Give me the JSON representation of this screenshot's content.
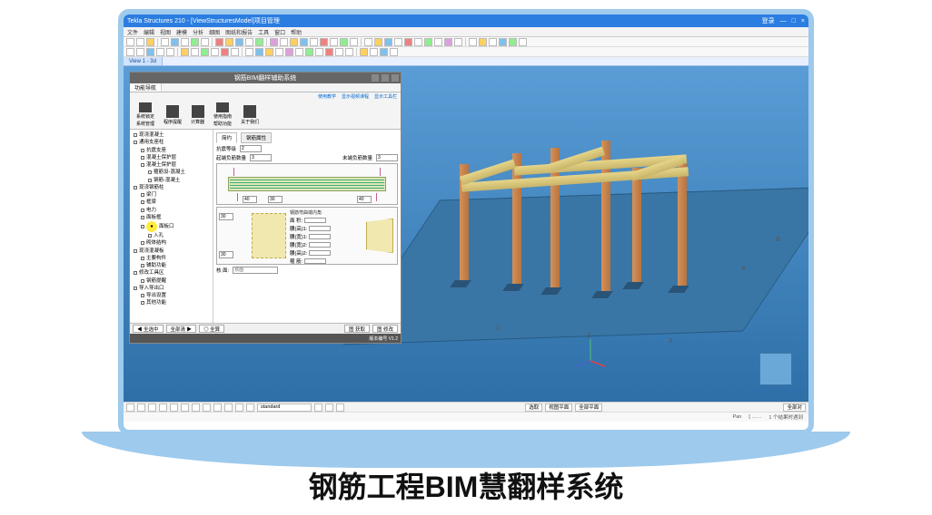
{
  "caption": "钢筋工程BIM慧翻样系统",
  "window": {
    "title": "Tekla Structures 210 - [ViewStructuresModel]项目管理",
    "user": "登录",
    "win_min": "—",
    "win_max": "□",
    "win_close": "×"
  },
  "menus": [
    "文件",
    "编辑",
    "视图",
    "建模",
    "分析",
    "细图",
    "图纸和报告",
    "工具",
    "窗口",
    "帮助"
  ],
  "view_tab": "View 1 - 3d",
  "axis": {
    "a1": "1",
    "a2": "2",
    "a3": "3",
    "aA": "A",
    "aB": "B"
  },
  "panel": {
    "title": "钢筋BIM翻样辅助系统",
    "tabs": [
      "功能导航"
    ],
    "help_links": [
      "使用教学",
      "显示视频课程",
      "显示工具栏"
    ],
    "ribbon": [
      {
        "label": "系统锁定",
        "sub": "系统管理"
      },
      {
        "label": "程序提醒"
      },
      {
        "label": "计算器"
      },
      {
        "label": "使用指南",
        "sub": "帮助功能"
      },
      {
        "label": "关于我们"
      }
    ],
    "tree": [
      {
        "t": "现浇混凝土",
        "lv": 0
      },
      {
        "t": "通用支座柱",
        "lv": 0,
        "icon": "M"
      },
      {
        "t": "抗震支座",
        "lv": 1
      },
      {
        "t": "混凝土保护层",
        "lv": 1
      },
      {
        "t": "混凝土保护层",
        "lv": 1
      },
      {
        "t": "箍筋设-混凝土",
        "lv": 2
      },
      {
        "t": "钢筋-混凝土",
        "lv": 2
      },
      {
        "t": "现浇钢筋柱",
        "lv": 0
      },
      {
        "t": "梁门",
        "lv": 1
      },
      {
        "t": "框梁",
        "lv": 1
      },
      {
        "t": "电力",
        "lv": 1
      },
      {
        "t": "面板框",
        "lv": 1
      },
      {
        "t": "面板口",
        "lv": 1,
        "sel": true
      },
      {
        "t": "入孔",
        "lv": 2
      },
      {
        "t": "砌体结构",
        "lv": 1
      },
      {
        "t": "现浇混凝板",
        "lv": 0
      },
      {
        "t": "主要构件",
        "lv": 1
      },
      {
        "t": "辅助功能",
        "lv": 1
      },
      {
        "t": "修改工具区",
        "lv": 0
      },
      {
        "t": "钢筋提醒",
        "lv": 1
      },
      {
        "t": "导入导出口",
        "lv": 0
      },
      {
        "t": "导出设置",
        "lv": 1
      },
      {
        "t": "其他功能",
        "lv": 1
      }
    ],
    "form": {
      "sub_tabs": [
        "简约",
        "钢筋属性"
      ],
      "active_sub": 0,
      "row1": {
        "label": "抗震等级",
        "val": "2"
      },
      "row2": {
        "left_label": "起端负筋数量",
        "left": "3",
        "right_label": "末端负筋数量",
        "right": "3"
      },
      "dims": {
        "d1": "40",
        "d2": "30",
        "d3": "40",
        "d4": "30",
        "d5": "30"
      },
      "angle_label": "钢筋弯曲端内角",
      "params": [
        {
          "l": "面 积:",
          "v": ""
        },
        {
          "l": "腰(高)1:",
          "v": ""
        },
        {
          "l": "腰(宽)1:",
          "v": ""
        },
        {
          "l": "腰(宽)2:",
          "v": ""
        },
        {
          "l": "腰(高)2:",
          "v": ""
        },
        {
          "l": "箍 筋:",
          "v": ""
        }
      ],
      "last": {
        "l": "核 面:",
        "hint": "核面"
      }
    },
    "footer": [
      "◀ 全选中",
      "全部清 ▶",
      "◎ 全算",
      "图 获取",
      "图 修改"
    ],
    "status": "版本编号 V1.2"
  },
  "bottom_bar": {
    "combo": "standard",
    "mid_btns": [
      "选取",
      "视图平面",
      "全部平面"
    ],
    "right_hint": "全部对"
  },
  "status2": {
    "pan": "Pan",
    "coords": "[ ……",
    "right": "1 个结果时遇到"
  }
}
